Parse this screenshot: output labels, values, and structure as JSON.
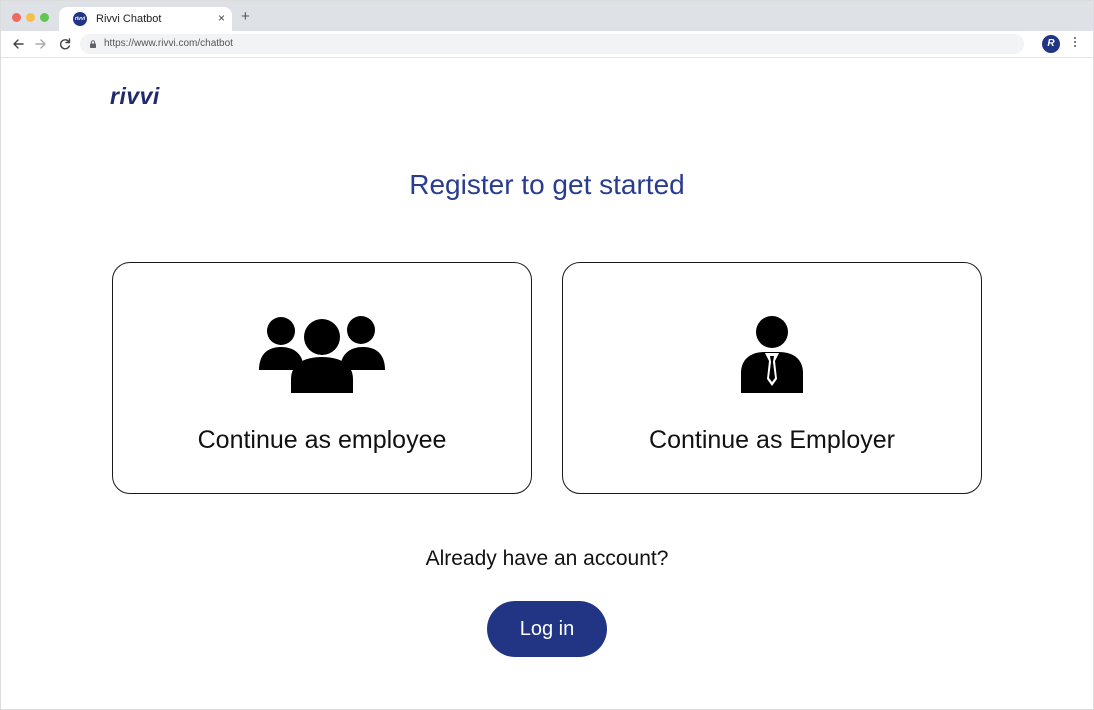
{
  "browser": {
    "tab_title": "Rivvi Chatbot",
    "tab_favicon_text": "rivvi",
    "tab_close": "×",
    "new_tab": "+",
    "url": "https://www.rivvi.com/chatbot",
    "profile_initial": "R"
  },
  "page": {
    "logo": "rivvi",
    "heading": "Register to get started",
    "cards": [
      {
        "label": "Continue as employee",
        "icon": "group-icon"
      },
      {
        "label": "Continue as Employer",
        "icon": "businessman-icon"
      }
    ],
    "account_prompt": "Already have an account?",
    "login_label": "Log in"
  },
  "colors": {
    "brand": "#223585",
    "heading": "#2a3c8e"
  }
}
